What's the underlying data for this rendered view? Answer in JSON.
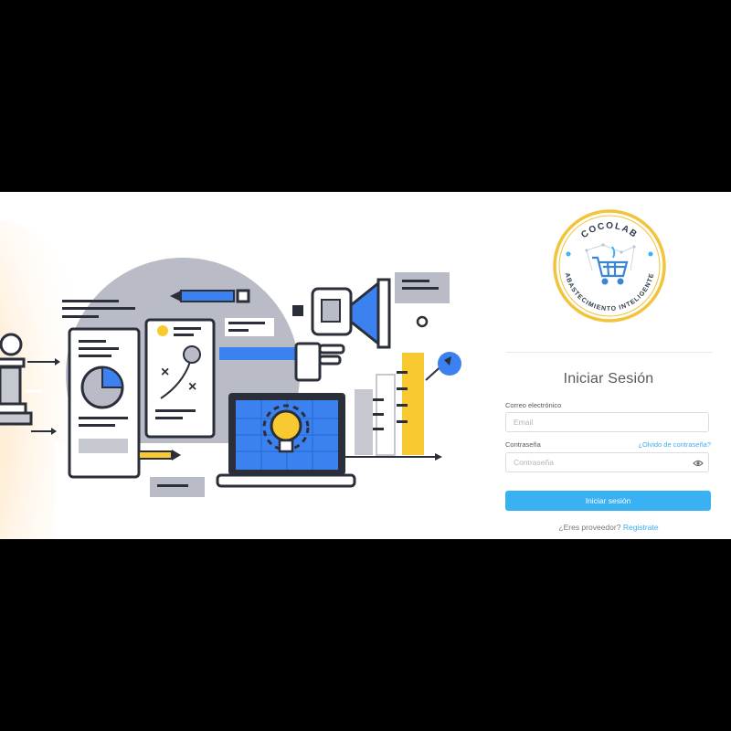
{
  "logo": {
    "top_text": "COCOLAB",
    "bottom_text": "ABASTECIMIENTO INTELIGENTE"
  },
  "login": {
    "title": "Iniciar Sesión",
    "email_label": "Correo electrónico",
    "email_placeholder": "Email",
    "password_label": "Contraseña",
    "password_placeholder": "Contraseña",
    "forgot_link": "¿Olvido de contraseña?",
    "submit_label": "Iniciar sesión",
    "register_prompt": "¿Eres proveedor?",
    "register_link": "Registrate"
  },
  "colors": {
    "accent": "#3ab1f2",
    "illustration_blue": "#3b82f0",
    "illustration_yellow": "#f9c932",
    "illustration_dark": "#2b2f3a",
    "illustration_gray": "#b9bcc6",
    "logo_ring": "#f3c33a",
    "logo_text": "#2c3a4a"
  },
  "icons": [
    "eye-icon",
    "shopping-cart-icon",
    "lightbulb-icon",
    "megaphone-icon",
    "pie-chart-icon",
    "chess-pawn-icon"
  ]
}
